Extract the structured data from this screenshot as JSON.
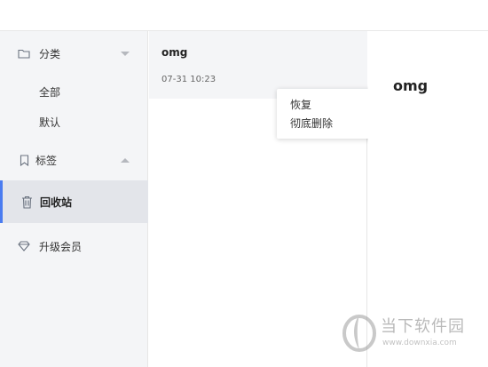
{
  "sidebar": {
    "category": {
      "label": "分类",
      "icon": "folder-icon",
      "expanded": true
    },
    "category_items": [
      {
        "label": "全部"
      },
      {
        "label": "默认"
      }
    ],
    "tags": {
      "label": "标签",
      "icon": "bookmark-icon",
      "expanded": false
    },
    "trash": {
      "label": "回收站",
      "icon": "trash-icon",
      "selected": true
    },
    "upgrade": {
      "label": "升级会员",
      "icon": "diamond-icon"
    }
  },
  "notes": [
    {
      "title": "omg",
      "date": "07-31 10:23"
    }
  ],
  "context_menu": {
    "restore": "恢复",
    "delete_permanently": "彻底删除"
  },
  "detail": {
    "title": "omg"
  },
  "watermark": {
    "name": "当下软件园",
    "url": "www.downxia.com"
  },
  "colors": {
    "accent": "#4a7cf0",
    "sidebar_bg": "#f4f5f7",
    "selected_bg": "#e3e5ea"
  }
}
